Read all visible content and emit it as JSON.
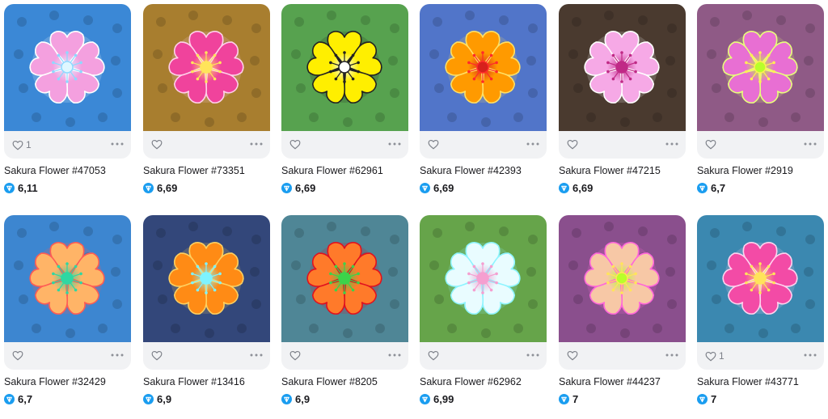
{
  "items": [
    {
      "title": "Sakura Flower #47053",
      "price": "6,11",
      "likes": "1",
      "bg": "#3b88d6",
      "petal": "#f4a0df",
      "center": "#dff7ff",
      "edge": "#ffffff",
      "stamen": "#8fd8ff"
    },
    {
      "title": "Sakura Flower #73351",
      "price": "6,69",
      "likes": "",
      "bg": "#a87e2f",
      "petal": "#f0439c",
      "center": "#ffe45a",
      "edge": "#ffd0ea",
      "stamen": "#ffe45a"
    },
    {
      "title": "Sakura Flower #62961",
      "price": "6,69",
      "likes": "",
      "bg": "#57a24f",
      "petal": "#ffef00",
      "center": "#ffffff",
      "edge": "#222222",
      "stamen": "#222222"
    },
    {
      "title": "Sakura Flower #42393",
      "price": "6,69",
      "likes": "",
      "bg": "#5175c9",
      "petal": "#ff9a00",
      "center": "#d6201c",
      "edge": "#ffe066",
      "stamen": "#ff2a2a"
    },
    {
      "title": "Sakura Flower #47215",
      "price": "6,69",
      "likes": "",
      "bg": "#4a3a2f",
      "petal": "#f6a9e6",
      "center": "#c02a86",
      "edge": "#ffffff",
      "stamen": "#c02a86"
    },
    {
      "title": "Sakura Flower #2919",
      "price": "6,7",
      "likes": "",
      "bg": "#8f5a86",
      "petal": "#e86fd3",
      "center": "#b8ff2a",
      "edge": "#e8ff7a",
      "stamen": "#ffee55"
    },
    {
      "title": "Sakura Flower #32429",
      "price": "6,7",
      "likes": "",
      "bg": "#3d86d0",
      "petal": "#ffb467",
      "center": "#2fd7a2",
      "edge": "#ff5b54",
      "stamen": "#2fd7a2"
    },
    {
      "title": "Sakura Flower #13416",
      "price": "6,9",
      "likes": "",
      "bg": "#33477a",
      "petal": "#ff8b15",
      "center": "#7ef3ff",
      "edge": "#ffd060",
      "stamen": "#7ef3ff"
    },
    {
      "title": "Sakura Flower #8205",
      "price": "6,9",
      "likes": "",
      "bg": "#4f8696",
      "petal": "#ff7a2a",
      "center": "#3bd34a",
      "edge": "#e0111f",
      "stamen": "#3bd34a"
    },
    {
      "title": "Sakura Flower #62962",
      "price": "6,99",
      "likes": "",
      "bg": "#66a44a",
      "petal": "#e9fcff",
      "center": "#f59fd0",
      "edge": "#8ef4ff",
      "stamen": "#f59fd0"
    },
    {
      "title": "Sakura Flower #44237",
      "price": "7",
      "likes": "",
      "bg": "#8a4f8d",
      "petal": "#f7c8a6",
      "center": "#b9ff2a",
      "edge": "#ff67d9",
      "stamen": "#ffe55a"
    },
    {
      "title": "Sakura Flower #43771",
      "price": "7",
      "likes": "1",
      "bg": "#3b88b0",
      "petal": "#f34ba6",
      "center": "#ffe45a",
      "edge": "#ffd3ef",
      "stamen": "#ffe45a"
    }
  ]
}
